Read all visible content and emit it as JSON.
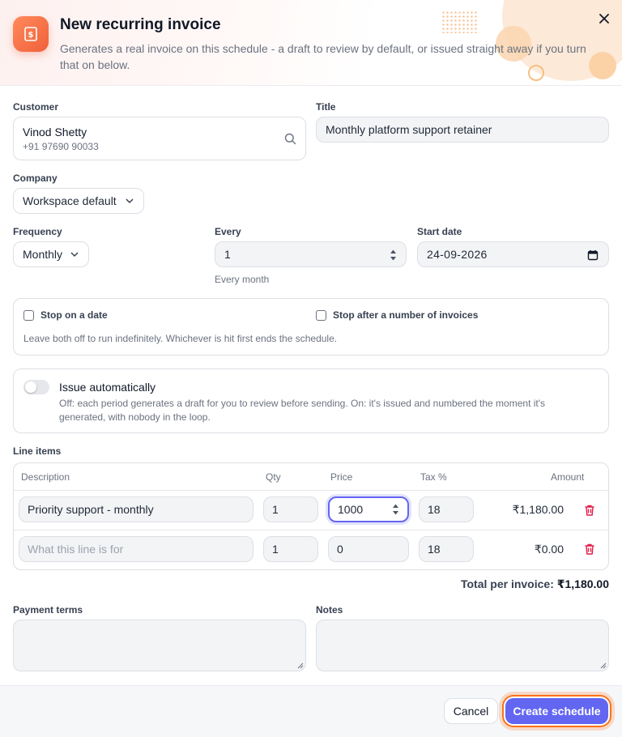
{
  "dialog": {
    "title": "New recurring invoice",
    "subtitle": "Generates a real invoice on this schedule - a draft to review by default, or issued straight away if you turn that on below."
  },
  "customer": {
    "label": "Customer",
    "name": "Vinod Shetty",
    "phone": "+91 97690 90033"
  },
  "title_field": {
    "label": "Title",
    "value": "Monthly platform support retainer"
  },
  "company": {
    "label": "Company",
    "value": "Workspace default"
  },
  "frequency": {
    "label": "Frequency",
    "value": "Monthly"
  },
  "every": {
    "label": "Every",
    "value": "1",
    "hint": "Every month"
  },
  "start_date": {
    "label": "Start date",
    "value": "24-09-2026"
  },
  "stop": {
    "on_date_label": "Stop on a date",
    "after_count_label": "Stop after a number of invoices",
    "hint": "Leave both off to run indefinitely. Whichever is hit first ends the schedule."
  },
  "auto_issue": {
    "label": "Issue automatically",
    "enabled": false,
    "description": "Off: each period generates a draft for you to review before sending. On: it's issued and numbered the moment it's generated, with nobody in the loop."
  },
  "line_items": {
    "label": "Line items",
    "headers": {
      "description": "Description",
      "qty": "Qty",
      "price": "Price",
      "tax": "Tax %",
      "amount": "Amount"
    },
    "rows": [
      {
        "description": "Priority support - monthly",
        "qty": "1",
        "price": "1000",
        "tax": "18",
        "amount": "₹1,180.00"
      },
      {
        "description": "",
        "placeholder": "What this line is for",
        "qty": "1",
        "price": "0",
        "tax": "18",
        "amount": "₹0.00"
      }
    ],
    "total_label": "Total per invoice:",
    "total_value": "₹1,180.00"
  },
  "payment_terms": {
    "label": "Payment terms",
    "value": ""
  },
  "notes": {
    "label": "Notes",
    "value": ""
  },
  "footer": {
    "cancel_label": "Cancel",
    "create_label": "Create schedule"
  },
  "colors": {
    "accent": "#6366f1",
    "brand": "#f0603a",
    "danger": "#e11d48",
    "focus_ring": "#f97316"
  },
  "icons": {
    "app": "invoice-icon",
    "close": "close-icon",
    "search": "search-icon",
    "chevron": "chevron-down-icon",
    "stepper": "stepper-icon",
    "calendar": "calendar-icon",
    "delete": "trash-icon"
  }
}
